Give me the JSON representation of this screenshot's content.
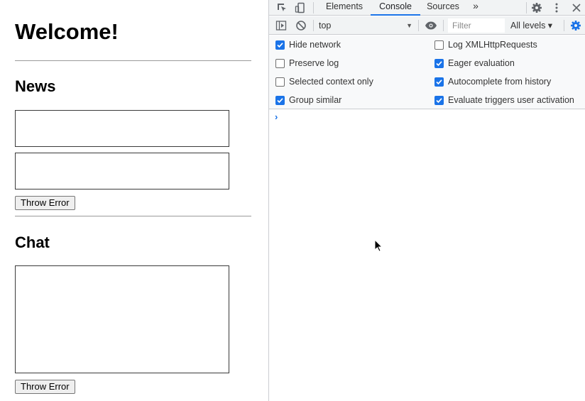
{
  "page": {
    "title": "Welcome!",
    "news_heading": "News",
    "chat_heading": "Chat",
    "news_button_label": "Throw Error",
    "chat_button_label": "Throw Error"
  },
  "devtools": {
    "tabs": [
      {
        "label": "Elements",
        "active": false
      },
      {
        "label": "Console",
        "active": true
      },
      {
        "label": "Sources",
        "active": false
      }
    ],
    "more_tabs": "»",
    "context": "top",
    "filter_placeholder": "Filter",
    "levels": "All levels ▾",
    "settings": [
      {
        "label": "Hide network",
        "checked": true
      },
      {
        "label": "Log XMLHttpRequests",
        "checked": false
      },
      {
        "label": "Preserve log",
        "checked": false
      },
      {
        "label": "Eager evaluation",
        "checked": true
      },
      {
        "label": "Selected context only",
        "checked": false
      },
      {
        "label": "Autocomplete from history",
        "checked": true
      },
      {
        "label": "Group similar",
        "checked": true
      },
      {
        "label": "Evaluate triggers user activation",
        "checked": true
      }
    ],
    "prompt": "›"
  },
  "colors": {
    "accent": "#1a73e8",
    "chrome_bg": "#f1f3f4",
    "border": "#cbcdd1"
  }
}
